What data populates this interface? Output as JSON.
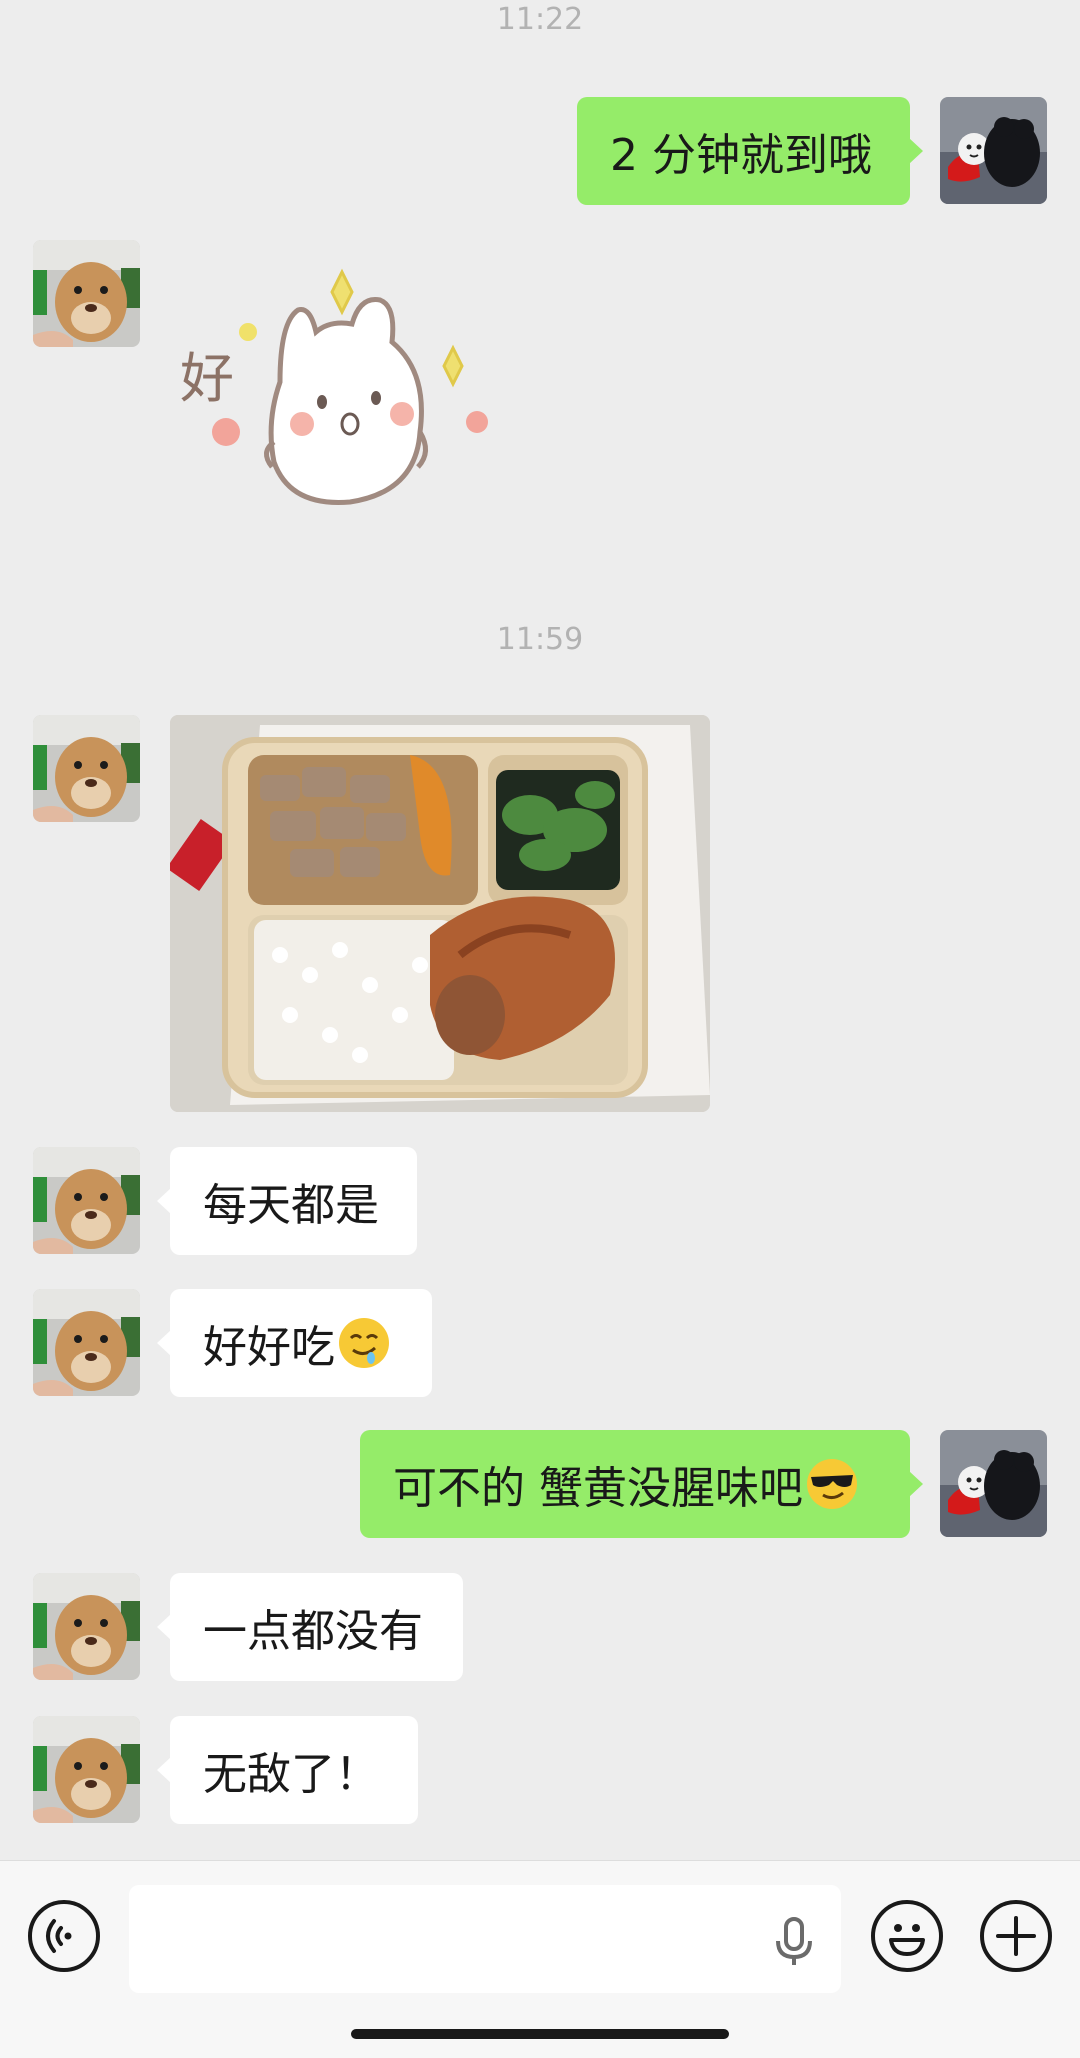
{
  "timestamps": [
    "11:22",
    "11:59"
  ],
  "messages": {
    "m1": "2 分钟就到哦",
    "m2_sticker_text": "好",
    "m3_text": "每天都是",
    "m4_text": "好好吃",
    "m4_emoji": "drooling-face-emoji",
    "m5_text": "可不的 蟹黄没腥味吧",
    "m5_emoji": "smiling-face-with-sunglasses-emoji",
    "m6_text": "一点都没有",
    "m7_text": "无敌了！"
  },
  "input_bar": {
    "voice_icon": "voice-icon",
    "mic_icon": "mic-icon",
    "emoji_icon": "emoji-icon",
    "plus_icon": "plus-icon",
    "input_value": ""
  },
  "colors": {
    "background": "#ededed",
    "outgoing_bubble": "#95ec69",
    "incoming_bubble": "#ffffff",
    "timestamp": "#b2b2b2"
  }
}
